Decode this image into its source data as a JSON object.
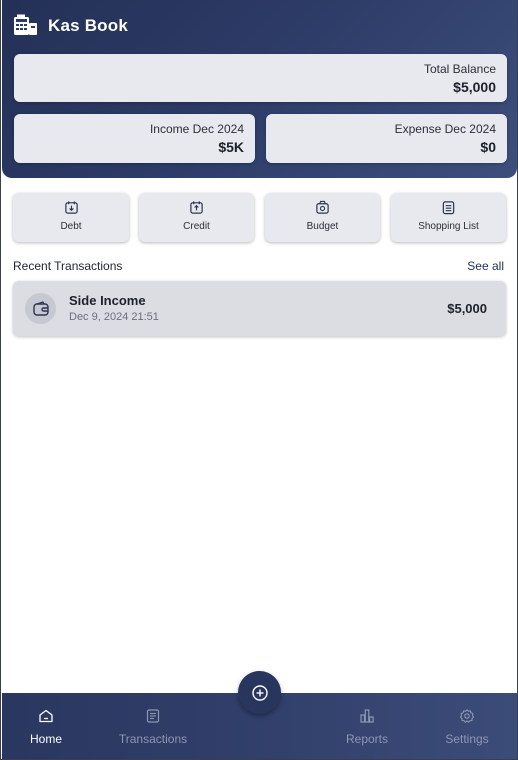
{
  "app": {
    "title": "Kas Book"
  },
  "summary": {
    "total_balance": {
      "label": "Total Balance",
      "value": "$5,000"
    },
    "income": {
      "label": "Income Dec 2024",
      "value": "$5K"
    },
    "expense": {
      "label": "Expense Dec 2024",
      "value": "$0"
    }
  },
  "quick_actions": [
    {
      "label": "Debt",
      "icon": "debt-icon"
    },
    {
      "label": "Credit",
      "icon": "credit-icon"
    },
    {
      "label": "Budget",
      "icon": "budget-icon"
    },
    {
      "label": "Shopping List",
      "icon": "shopping-list-icon"
    }
  ],
  "recent": {
    "title": "Recent Transactions",
    "see_all": "See all",
    "items": [
      {
        "name": "Side Income",
        "date": "Dec 9, 2024 21:51",
        "amount": "$5,000",
        "icon": "wallet-icon"
      }
    ]
  },
  "bottom_nav": {
    "active": "Home",
    "items": [
      {
        "label": "Home",
        "icon": "home-icon"
      },
      {
        "label": "Transactions",
        "icon": "transactions-icon"
      },
      {
        "label": "Reports",
        "icon": "reports-icon"
      },
      {
        "label": "Settings",
        "icon": "settings-icon"
      }
    ],
    "fab_icon": "add-icon"
  },
  "colors": {
    "header": "#2c3b66",
    "card": "#e8e9ee",
    "nav_active": "#ffffff",
    "nav_inactive": "#8e97b3",
    "fab": "#28355c"
  }
}
